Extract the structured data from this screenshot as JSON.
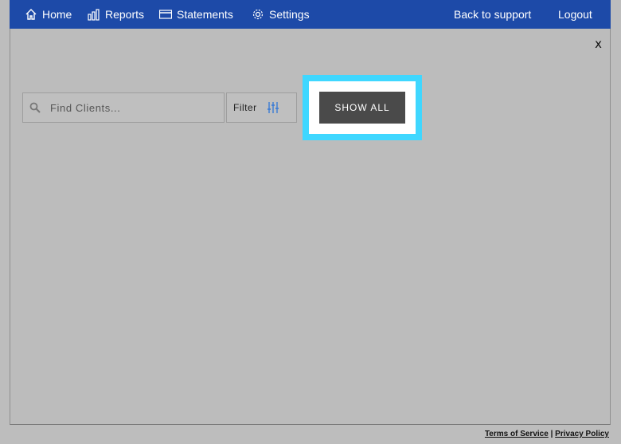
{
  "nav": {
    "home": "Home",
    "reports": "Reports",
    "statements": "Statements",
    "settings": "Settings",
    "back_to_support": "Back to support",
    "logout": "Logout"
  },
  "panel": {
    "close_label": "x",
    "search": {
      "placeholder": "Find Clients...",
      "value": ""
    },
    "filter_label": "Filter",
    "show_all_label": "SHOW ALL"
  },
  "footer": {
    "terms": "Terms of Service",
    "separator": "|",
    "privacy": "Privacy Policy"
  },
  "colors": {
    "nav_bar": "#1d4aa8",
    "overlay": "#bcbcbc",
    "highlight": "#3fd7ff",
    "button": "#4a4a4a",
    "filter_icon": "#3a7bd5"
  }
}
